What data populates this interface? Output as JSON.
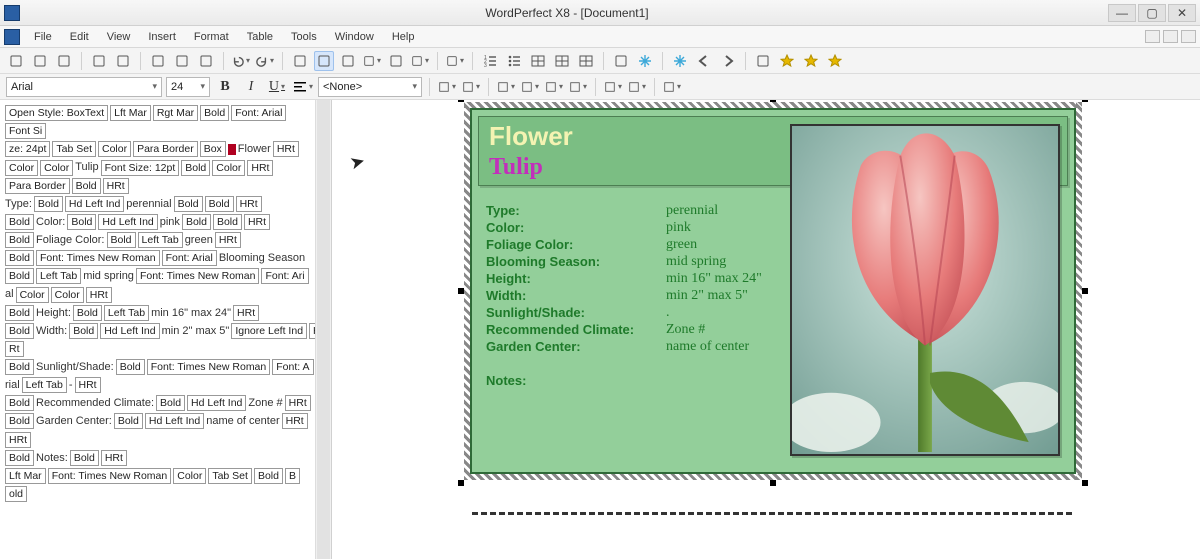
{
  "titlebar": {
    "title": "WordPerfect X8 - [Document1]"
  },
  "menu": {
    "items": [
      "File",
      "Edit",
      "View",
      "Insert",
      "Format",
      "Table",
      "Tools",
      "Window",
      "Help"
    ]
  },
  "propbar": {
    "font": "Arial",
    "size": "24",
    "style": "<None>"
  },
  "reveal_codes": [
    [
      {
        "t": "c",
        "v": "Open Style: BoxText"
      },
      {
        "t": "c",
        "v": "Lft Mar"
      },
      {
        "t": "c",
        "v": "Rgt Mar"
      },
      {
        "t": "c",
        "v": "Bold"
      },
      {
        "t": "c",
        "v": "Font: Arial"
      },
      {
        "t": "c",
        "v": "Font Si"
      }
    ],
    [
      {
        "t": "c",
        "v": "ze: 24pt"
      },
      {
        "t": "c",
        "v": "Tab Set"
      },
      {
        "t": "c",
        "v": "Color"
      },
      {
        "t": "c",
        "v": "Para Border"
      },
      {
        "t": "c",
        "v": "Box"
      },
      {
        "t": "r"
      },
      {
        "t": "p",
        "v": "Flower"
      },
      {
        "t": "c",
        "v": "HRt"
      }
    ],
    [
      {
        "t": "c",
        "v": "Color"
      },
      {
        "t": "c",
        "v": "Color"
      },
      {
        "t": "p",
        "v": "Tulip"
      },
      {
        "t": "c",
        "v": "Font Size: 12pt"
      },
      {
        "t": "c",
        "v": "Bold"
      },
      {
        "t": "c",
        "v": "Color"
      },
      {
        "t": "c",
        "v": "HRt"
      }
    ],
    [
      {
        "t": "c",
        "v": "Para Border"
      },
      {
        "t": "c",
        "v": "Bold"
      },
      {
        "t": "c",
        "v": "HRt"
      }
    ],
    [
      {
        "t": "p",
        "v": "Type:"
      },
      {
        "t": "c",
        "v": "Bold"
      },
      {
        "t": "c",
        "v": "Hd Left Ind"
      },
      {
        "t": "p",
        "v": "perennial"
      },
      {
        "t": "c",
        "v": "Bold"
      },
      {
        "t": "c",
        "v": "Bold"
      },
      {
        "t": "c",
        "v": "HRt"
      }
    ],
    [
      {
        "t": "c",
        "v": "Bold"
      },
      {
        "t": "p",
        "v": "Color:"
      },
      {
        "t": "c",
        "v": "Bold"
      },
      {
        "t": "c",
        "v": "Hd Left Ind"
      },
      {
        "t": "p",
        "v": "pink"
      },
      {
        "t": "c",
        "v": "Bold"
      },
      {
        "t": "c",
        "v": "Bold"
      },
      {
        "t": "c",
        "v": "HRt"
      }
    ],
    [
      {
        "t": "c",
        "v": "Bold"
      },
      {
        "t": "p",
        "v": "Foliage Color:"
      },
      {
        "t": "c",
        "v": "Bold"
      },
      {
        "t": "c",
        "v": "Left Tab"
      },
      {
        "t": "p",
        "v": "green"
      },
      {
        "t": "c",
        "v": "HRt"
      }
    ],
    [
      {
        "t": "c",
        "v": "Bold"
      },
      {
        "t": "c",
        "v": "Font: Times New Roman"
      },
      {
        "t": "c",
        "v": "Font: Arial"
      },
      {
        "t": "p",
        "v": "Blooming Season"
      }
    ],
    [
      {
        "t": "c",
        "v": "Bold"
      },
      {
        "t": "c",
        "v": "Left Tab"
      },
      {
        "t": "p",
        "v": "mid spring"
      },
      {
        "t": "c",
        "v": "Font: Times New Roman"
      },
      {
        "t": "c",
        "v": "Font: Ari"
      }
    ],
    [
      {
        "t": "p",
        "v": "al"
      },
      {
        "t": "c",
        "v": "Color"
      },
      {
        "t": "c",
        "v": "Color"
      },
      {
        "t": "c",
        "v": "HRt"
      }
    ],
    [
      {
        "t": "c",
        "v": "Bold"
      },
      {
        "t": "p",
        "v": "Height:"
      },
      {
        "t": "c",
        "v": "Bold"
      },
      {
        "t": "c",
        "v": "Left Tab"
      },
      {
        "t": "p",
        "v": "min 16\" max 24\""
      },
      {
        "t": "c",
        "v": "HRt"
      }
    ],
    [
      {
        "t": "c",
        "v": "Bold"
      },
      {
        "t": "p",
        "v": "Width:"
      },
      {
        "t": "c",
        "v": "Bold"
      },
      {
        "t": "c",
        "v": "Hd Left Ind"
      },
      {
        "t": "p",
        "v": "min 2\" max 5\""
      },
      {
        "t": "c",
        "v": "Ignore Left Ind"
      },
      {
        "t": "c",
        "v": "H"
      }
    ],
    [
      {
        "t": "c",
        "v": "Rt"
      }
    ],
    [
      {
        "t": "c",
        "v": "Bold"
      },
      {
        "t": "p",
        "v": "Sunlight/Shade:"
      },
      {
        "t": "c",
        "v": "Bold"
      },
      {
        "t": "c",
        "v": "Font: Times New Roman"
      },
      {
        "t": "c",
        "v": "Font: A"
      }
    ],
    [
      {
        "t": "p",
        "v": "rial"
      },
      {
        "t": "c",
        "v": "Left Tab"
      },
      {
        "t": "p",
        "v": "-"
      },
      {
        "t": "c",
        "v": "HRt"
      }
    ],
    [
      {
        "t": "c",
        "v": "Bold"
      },
      {
        "t": "p",
        "v": "Recommended Climate:"
      },
      {
        "t": "c",
        "v": "Bold"
      },
      {
        "t": "c",
        "v": "Hd Left Ind"
      },
      {
        "t": "p",
        "v": "Zone #"
      },
      {
        "t": "c",
        "v": "HRt"
      }
    ],
    [
      {
        "t": "c",
        "v": "Bold"
      },
      {
        "t": "p",
        "v": "Garden Center:"
      },
      {
        "t": "c",
        "v": "Bold"
      },
      {
        "t": "c",
        "v": "Hd Left Ind"
      },
      {
        "t": "p",
        "v": "name of center"
      },
      {
        "t": "c",
        "v": "HRt"
      }
    ],
    [
      {
        "t": "c",
        "v": "HRt"
      }
    ],
    [
      {
        "t": "c",
        "v": "Bold"
      },
      {
        "t": "p",
        "v": "Notes:"
      },
      {
        "t": "c",
        "v": "Bold"
      },
      {
        "t": "c",
        "v": "HRt"
      }
    ],
    [
      {
        "t": "c",
        "v": "Lft Mar"
      },
      {
        "t": "c",
        "v": "Font: Times New Roman"
      },
      {
        "t": "c",
        "v": "Color"
      },
      {
        "t": "c",
        "v": "Tab Set"
      },
      {
        "t": "c",
        "v": "Bold"
      },
      {
        "t": "c",
        "v": "B"
      }
    ],
    [
      {
        "t": "c",
        "v": "old"
      }
    ]
  ],
  "card": {
    "header1": "Flower",
    "header2": "Tulip",
    "rows": [
      {
        "label": "Type:",
        "value": "perennial"
      },
      {
        "label": "Color:",
        "value": "pink"
      },
      {
        "label": "Foliage Color:",
        "value": "green"
      },
      {
        "label": "Blooming Season:",
        "value": "mid spring"
      },
      {
        "label": "Height:",
        "value": "min 16\" max 24\""
      },
      {
        "label": "Width:",
        "value": "min 2\" max 5\""
      },
      {
        "label": "Sunlight/Shade:",
        "value": "."
      },
      {
        "label": "Recommended Climate:",
        "value": "Zone #"
      },
      {
        "label": "Garden Center:",
        "value": "name of center"
      }
    ],
    "notes_label": "Notes:"
  },
  "toolbar_icons": [
    "new-icon",
    "open-icon",
    "save-icon",
    "print-icon",
    "preview-icon",
    "cut-icon",
    "copy-icon",
    "paste-icon",
    "undo-icon",
    "redo-icon",
    "clipart-icon",
    "textbox-icon",
    "chart-icon",
    "highlight-icon",
    "dropcap-icon",
    "font-color-icon",
    "columns-icon",
    "numbered-list-icon",
    "bullet-list-icon",
    "table-icon",
    "borders-icon",
    "grid-icon",
    "book-icon",
    "snowflake-icon",
    "sparkle-icon",
    "arrow-left-icon",
    "arrow-right-icon",
    "home-icon",
    "favorite-icon",
    "star-icon",
    "award-icon"
  ],
  "propbar_icons": [
    "bold-button",
    "italic-button",
    "underline-button",
    "align-button",
    "style-select",
    "spellcheck-a-icon",
    "spellcheck-b-icon",
    "promote-icon",
    "demote-icon",
    "indent-left-icon",
    "indent-right-icon",
    "border-side-icon",
    "border-all-icon",
    "view-codes-icon"
  ]
}
